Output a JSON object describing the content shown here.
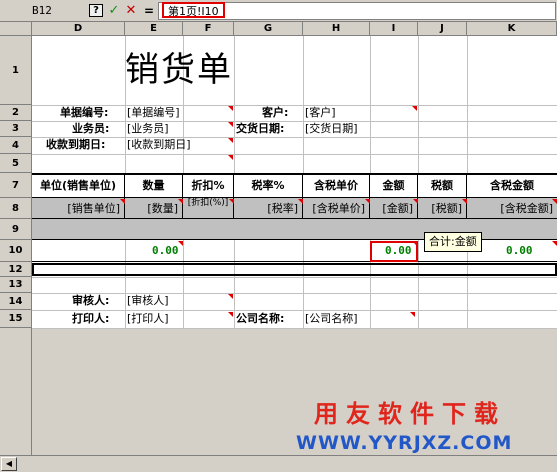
{
  "formula_bar": {
    "namebox": "B12",
    "help": "?",
    "ok": "✓",
    "cancel": "✕",
    "eq": "=",
    "formula": "第1页!I10"
  },
  "columns": [
    "D",
    "E",
    "F",
    "G",
    "H",
    "I",
    "J",
    "K"
  ],
  "rows": [
    "1",
    "2",
    "3",
    "4",
    "5",
    "7",
    "8",
    "9",
    "10",
    "12",
    "13",
    "14",
    "15"
  ],
  "title": "销货单",
  "fields": {
    "doc_no_label": "单据编号:",
    "doc_no_value": "[单据编号]",
    "customer_label": "客户:",
    "customer_value": "[客户]",
    "salesman_label": "业务员:",
    "salesman_value": "[业务员]",
    "delivery_label": "交货日期:",
    "delivery_value": "[交货日期]",
    "due_label": "收款到期日:",
    "due_value": "[收款到期日]",
    "reviewer_label": "审核人:",
    "reviewer_value": "[审核人]",
    "printer_label": "打印人:",
    "printer_value": "[打印人]",
    "company_label": "公司名称:",
    "company_value": "[公司名称]"
  },
  "table": {
    "headers": [
      "单位(销售单位)",
      "数量",
      "折扣%",
      "税率%",
      "含税单价",
      "金额",
      "税额",
      "含税金额"
    ],
    "bindings": [
      "[销售单位]",
      "[数量]",
      "[折扣(%)]",
      "[税率]",
      "[含税单价]",
      "[金额]",
      "[税额]",
      "[含税金额]"
    ],
    "row10_qty": "0.00",
    "row10_amount": "0.00",
    "row10_total": "0.00"
  },
  "tooltip": "合计:金额",
  "watermark": {
    "line1": "用友软件下载",
    "line2": "WWW.YYRJXZ.COM"
  }
}
